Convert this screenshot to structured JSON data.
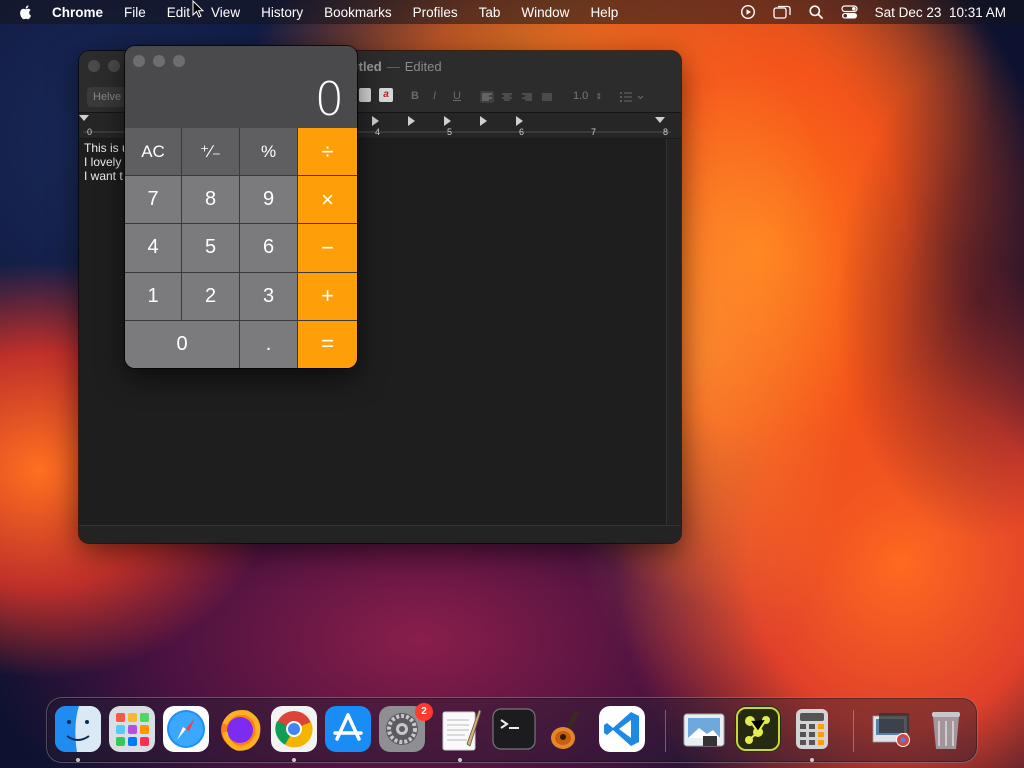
{
  "menubar": {
    "app_name": "Chrome",
    "items": [
      "File",
      "Edit",
      "View",
      "History",
      "Bookmarks",
      "Profiles",
      "Tab",
      "Window",
      "Help"
    ],
    "clock": "Sat Dec 23  10:31 AM",
    "status_icons": [
      "screen-recording-icon",
      "screen-mirroring-icon",
      "spotlight-search-icon",
      "control-center-icon"
    ]
  },
  "textedit": {
    "title": "Untitled",
    "title_visible": "itled",
    "status": "Edited",
    "font_name": "Helve",
    "line_spacing": "1.0",
    "format_buttons": [
      "B",
      "I",
      "U"
    ],
    "ruler_numbers": [
      "0",
      "4",
      "5",
      "6",
      "7",
      "8"
    ],
    "text_lines": [
      "This is u",
      "I lovely",
      "I want t"
    ]
  },
  "calculator": {
    "display": "0",
    "keys": [
      {
        "label": "AC",
        "kind": "fn",
        "name": "clear-button"
      },
      {
        "label": "⁺∕₋",
        "kind": "fn",
        "name": "sign-toggle-button"
      },
      {
        "label": "%",
        "kind": "fn",
        "name": "percent-button"
      },
      {
        "label": "÷",
        "kind": "op",
        "name": "divide-button"
      },
      {
        "label": "7",
        "kind": "num",
        "name": "digit-7-button"
      },
      {
        "label": "8",
        "kind": "num",
        "name": "digit-8-button"
      },
      {
        "label": "9",
        "kind": "num",
        "name": "digit-9-button"
      },
      {
        "label": "×",
        "kind": "op",
        "name": "multiply-button"
      },
      {
        "label": "4",
        "kind": "num",
        "name": "digit-4-button"
      },
      {
        "label": "5",
        "kind": "num",
        "name": "digit-5-button"
      },
      {
        "label": "6",
        "kind": "num",
        "name": "digit-6-button"
      },
      {
        "label": "−",
        "kind": "op",
        "name": "subtract-button"
      },
      {
        "label": "1",
        "kind": "num",
        "name": "digit-1-button"
      },
      {
        "label": "2",
        "kind": "num",
        "name": "digit-2-button"
      },
      {
        "label": "3",
        "kind": "num",
        "name": "digit-3-button"
      },
      {
        "label": "+",
        "kind": "op",
        "name": "add-button"
      },
      {
        "label": "0",
        "kind": "num zero",
        "name": "digit-0-button"
      },
      {
        "label": ".",
        "kind": "num",
        "name": "decimal-button"
      },
      {
        "label": "=",
        "kind": "op",
        "name": "equals-button"
      }
    ]
  },
  "dock": {
    "apps": [
      {
        "name": "finder-icon",
        "running": true
      },
      {
        "name": "launchpad-icon",
        "running": false
      },
      {
        "name": "safari-icon",
        "running": false
      },
      {
        "name": "firefox-icon",
        "running": false
      },
      {
        "name": "chrome-icon",
        "running": true
      },
      {
        "name": "app-store-icon",
        "running": false
      },
      {
        "name": "system-settings-icon",
        "running": false,
        "badge": "2"
      },
      {
        "name": "textedit-icon",
        "running": true
      },
      {
        "name": "terminal-icon",
        "running": false
      },
      {
        "name": "garageband-icon",
        "running": false
      },
      {
        "name": "vscode-icon",
        "running": false
      },
      {
        "name": "preview-icon",
        "running": false
      },
      {
        "name": "molecule-app-icon",
        "running": false
      },
      {
        "name": "calculator-icon",
        "running": true
      },
      {
        "name": "downloads-stack-icon",
        "running": false
      },
      {
        "name": "trash-icon",
        "running": false
      }
    ]
  },
  "colors": {
    "calc_operator": "#fe9f0a",
    "calc_number": "#7b7b7d",
    "calc_function": "#5f5f61",
    "badge": "#ff3b30"
  }
}
